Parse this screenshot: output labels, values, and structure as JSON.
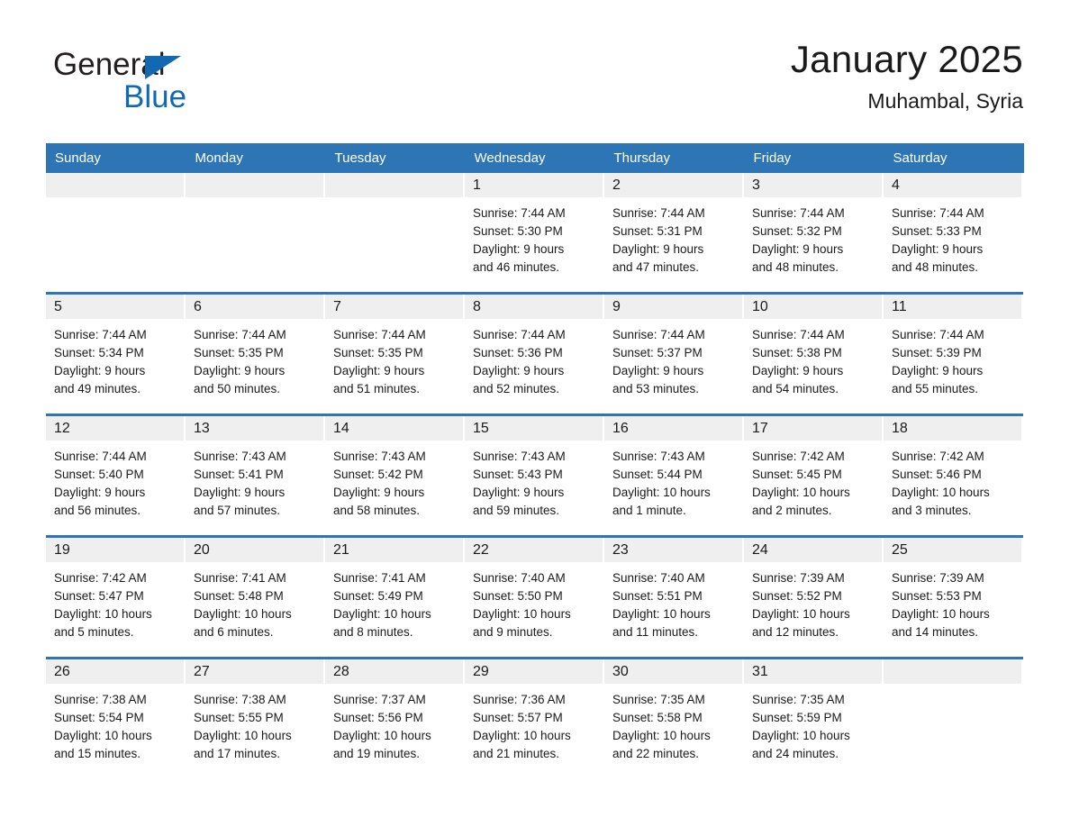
{
  "brand": {
    "name_dark": "General",
    "name_light": "Blue",
    "triangle_color": "#1268b3",
    "accent_color": "#2e75b6"
  },
  "header": {
    "title": "January 2025",
    "location": "Muhambal, Syria"
  },
  "weekday_headers": [
    "Sunday",
    "Monday",
    "Tuesday",
    "Wednesday",
    "Thursday",
    "Friday",
    "Saturday"
  ],
  "labels": {
    "sunrise_prefix": "Sunrise:",
    "sunset_prefix": "Sunset:",
    "daylight_prefix": "Daylight:"
  },
  "weeks": [
    [
      {
        "blank": true,
        "day": ""
      },
      {
        "blank": true,
        "day": ""
      },
      {
        "blank": true,
        "day": ""
      },
      {
        "blank": false,
        "day": "1",
        "sunrise": "Sunrise: 7:44 AM",
        "sunset": "Sunset: 5:30 PM",
        "daylight1": "Daylight: 9 hours",
        "daylight2": "and 46 minutes."
      },
      {
        "blank": false,
        "day": "2",
        "sunrise": "Sunrise: 7:44 AM",
        "sunset": "Sunset: 5:31 PM",
        "daylight1": "Daylight: 9 hours",
        "daylight2": "and 47 minutes."
      },
      {
        "blank": false,
        "day": "3",
        "sunrise": "Sunrise: 7:44 AM",
        "sunset": "Sunset: 5:32 PM",
        "daylight1": "Daylight: 9 hours",
        "daylight2": "and 48 minutes."
      },
      {
        "blank": false,
        "day": "4",
        "sunrise": "Sunrise: 7:44 AM",
        "sunset": "Sunset: 5:33 PM",
        "daylight1": "Daylight: 9 hours",
        "daylight2": "and 48 minutes."
      }
    ],
    [
      {
        "blank": false,
        "day": "5",
        "sunrise": "Sunrise: 7:44 AM",
        "sunset": "Sunset: 5:34 PM",
        "daylight1": "Daylight: 9 hours",
        "daylight2": "and 49 minutes."
      },
      {
        "blank": false,
        "day": "6",
        "sunrise": "Sunrise: 7:44 AM",
        "sunset": "Sunset: 5:35 PM",
        "daylight1": "Daylight: 9 hours",
        "daylight2": "and 50 minutes."
      },
      {
        "blank": false,
        "day": "7",
        "sunrise": "Sunrise: 7:44 AM",
        "sunset": "Sunset: 5:35 PM",
        "daylight1": "Daylight: 9 hours",
        "daylight2": "and 51 minutes."
      },
      {
        "blank": false,
        "day": "8",
        "sunrise": "Sunrise: 7:44 AM",
        "sunset": "Sunset: 5:36 PM",
        "daylight1": "Daylight: 9 hours",
        "daylight2": "and 52 minutes."
      },
      {
        "blank": false,
        "day": "9",
        "sunrise": "Sunrise: 7:44 AM",
        "sunset": "Sunset: 5:37 PM",
        "daylight1": "Daylight: 9 hours",
        "daylight2": "and 53 minutes."
      },
      {
        "blank": false,
        "day": "10",
        "sunrise": "Sunrise: 7:44 AM",
        "sunset": "Sunset: 5:38 PM",
        "daylight1": "Daylight: 9 hours",
        "daylight2": "and 54 minutes."
      },
      {
        "blank": false,
        "day": "11",
        "sunrise": "Sunrise: 7:44 AM",
        "sunset": "Sunset: 5:39 PM",
        "daylight1": "Daylight: 9 hours",
        "daylight2": "and 55 minutes."
      }
    ],
    [
      {
        "blank": false,
        "day": "12",
        "sunrise": "Sunrise: 7:44 AM",
        "sunset": "Sunset: 5:40 PM",
        "daylight1": "Daylight: 9 hours",
        "daylight2": "and 56 minutes."
      },
      {
        "blank": false,
        "day": "13",
        "sunrise": "Sunrise: 7:43 AM",
        "sunset": "Sunset: 5:41 PM",
        "daylight1": "Daylight: 9 hours",
        "daylight2": "and 57 minutes."
      },
      {
        "blank": false,
        "day": "14",
        "sunrise": "Sunrise: 7:43 AM",
        "sunset": "Sunset: 5:42 PM",
        "daylight1": "Daylight: 9 hours",
        "daylight2": "and 58 minutes."
      },
      {
        "blank": false,
        "day": "15",
        "sunrise": "Sunrise: 7:43 AM",
        "sunset": "Sunset: 5:43 PM",
        "daylight1": "Daylight: 9 hours",
        "daylight2": "and 59 minutes."
      },
      {
        "blank": false,
        "day": "16",
        "sunrise": "Sunrise: 7:43 AM",
        "sunset": "Sunset: 5:44 PM",
        "daylight1": "Daylight: 10 hours",
        "daylight2": "and 1 minute."
      },
      {
        "blank": false,
        "day": "17",
        "sunrise": "Sunrise: 7:42 AM",
        "sunset": "Sunset: 5:45 PM",
        "daylight1": "Daylight: 10 hours",
        "daylight2": "and 2 minutes."
      },
      {
        "blank": false,
        "day": "18",
        "sunrise": "Sunrise: 7:42 AM",
        "sunset": "Sunset: 5:46 PM",
        "daylight1": "Daylight: 10 hours",
        "daylight2": "and 3 minutes."
      }
    ],
    [
      {
        "blank": false,
        "day": "19",
        "sunrise": "Sunrise: 7:42 AM",
        "sunset": "Sunset: 5:47 PM",
        "daylight1": "Daylight: 10 hours",
        "daylight2": "and 5 minutes."
      },
      {
        "blank": false,
        "day": "20",
        "sunrise": "Sunrise: 7:41 AM",
        "sunset": "Sunset: 5:48 PM",
        "daylight1": "Daylight: 10 hours",
        "daylight2": "and 6 minutes."
      },
      {
        "blank": false,
        "day": "21",
        "sunrise": "Sunrise: 7:41 AM",
        "sunset": "Sunset: 5:49 PM",
        "daylight1": "Daylight: 10 hours",
        "daylight2": "and 8 minutes."
      },
      {
        "blank": false,
        "day": "22",
        "sunrise": "Sunrise: 7:40 AM",
        "sunset": "Sunset: 5:50 PM",
        "daylight1": "Daylight: 10 hours",
        "daylight2": "and 9 minutes."
      },
      {
        "blank": false,
        "day": "23",
        "sunrise": "Sunrise: 7:40 AM",
        "sunset": "Sunset: 5:51 PM",
        "daylight1": "Daylight: 10 hours",
        "daylight2": "and 11 minutes."
      },
      {
        "blank": false,
        "day": "24",
        "sunrise": "Sunrise: 7:39 AM",
        "sunset": "Sunset: 5:52 PM",
        "daylight1": "Daylight: 10 hours",
        "daylight2": "and 12 minutes."
      },
      {
        "blank": false,
        "day": "25",
        "sunrise": "Sunrise: 7:39 AM",
        "sunset": "Sunset: 5:53 PM",
        "daylight1": "Daylight: 10 hours",
        "daylight2": "and 14 minutes."
      }
    ],
    [
      {
        "blank": false,
        "day": "26",
        "sunrise": "Sunrise: 7:38 AM",
        "sunset": "Sunset: 5:54 PM",
        "daylight1": "Daylight: 10 hours",
        "daylight2": "and 15 minutes."
      },
      {
        "blank": false,
        "day": "27",
        "sunrise": "Sunrise: 7:38 AM",
        "sunset": "Sunset: 5:55 PM",
        "daylight1": "Daylight: 10 hours",
        "daylight2": "and 17 minutes."
      },
      {
        "blank": false,
        "day": "28",
        "sunrise": "Sunrise: 7:37 AM",
        "sunset": "Sunset: 5:56 PM",
        "daylight1": "Daylight: 10 hours",
        "daylight2": "and 19 minutes."
      },
      {
        "blank": false,
        "day": "29",
        "sunrise": "Sunrise: 7:36 AM",
        "sunset": "Sunset: 5:57 PM",
        "daylight1": "Daylight: 10 hours",
        "daylight2": "and 21 minutes."
      },
      {
        "blank": false,
        "day": "30",
        "sunrise": "Sunrise: 7:35 AM",
        "sunset": "Sunset: 5:58 PM",
        "daylight1": "Daylight: 10 hours",
        "daylight2": "and 22 minutes."
      },
      {
        "blank": false,
        "day": "31",
        "sunrise": "Sunrise: 7:35 AM",
        "sunset": "Sunset: 5:59 PM",
        "daylight1": "Daylight: 10 hours",
        "daylight2": "and 24 minutes."
      },
      {
        "blank": true,
        "day": ""
      }
    ]
  ]
}
